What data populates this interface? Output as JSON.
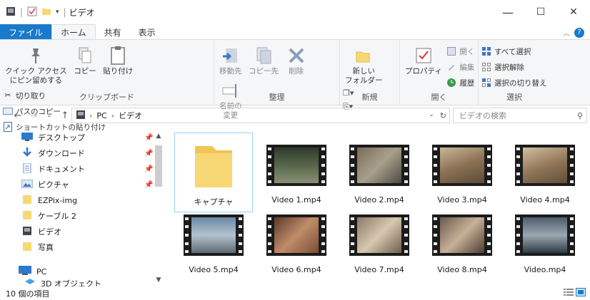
{
  "window": {
    "title": "ビデオ",
    "minimize": "—",
    "maximize": "☐",
    "close": "✕"
  },
  "tabs": [
    {
      "label": "ファイル"
    },
    {
      "label": "ホーム"
    },
    {
      "label": "共有"
    },
    {
      "label": "表示"
    }
  ],
  "ribbon": {
    "clipboard": {
      "label": "クリップボード",
      "pin": "クイック アクセス\nにピン留めする",
      "copy": "コピー",
      "paste": "貼り付け",
      "cut": "切り取り",
      "copy_path": "パスのコピー",
      "paste_shortcut": "ショートカットの貼り付け"
    },
    "organize": {
      "label": "整理",
      "move_to": "移動先",
      "copy_to": "コピー先",
      "delete": "削除",
      "rename": "名前の\n変更"
    },
    "new": {
      "label": "新規",
      "new_folder": "新しい\nフォルダー"
    },
    "open": {
      "label": "開く",
      "properties": "プロパティ",
      "open": "開く",
      "edit": "編集",
      "history": "履歴"
    },
    "select": {
      "label": "選択",
      "select_all": "すべて選択",
      "select_none": "選択解除",
      "invert": "選択の切り替え"
    }
  },
  "address": {
    "path": [
      "PC",
      "ビデオ"
    ],
    "search_placeholder": "ビデオの検索"
  },
  "nav_pane": [
    {
      "label": "デスクトップ",
      "icon": "desktop-icon",
      "pinned": true
    },
    {
      "label": "ダウンロード",
      "icon": "download-icon",
      "pinned": true
    },
    {
      "label": "ドキュメント",
      "icon": "document-icon",
      "pinned": true
    },
    {
      "label": "ピクチャ",
      "icon": "pictures-icon",
      "pinned": true
    },
    {
      "label": "EZPix-img",
      "icon": "folder-icon",
      "pinned": false
    },
    {
      "label": "ケーブル 2",
      "icon": "folder-icon",
      "pinned": false
    },
    {
      "label": "ビデオ",
      "icon": "video-folder-icon",
      "pinned": false
    },
    {
      "label": "写真",
      "icon": "folder-icon",
      "pinned": false
    },
    {
      "label": "PC",
      "icon": "pc-icon",
      "pinned": false
    },
    {
      "label": "3D オブジェクト",
      "icon": "3d-objects-icon",
      "pinned": false
    }
  ],
  "items": [
    {
      "name": "キャプチャ",
      "type": "folder"
    },
    {
      "name": "Video 1.mp4",
      "type": "video"
    },
    {
      "name": "Video 2.mp4",
      "type": "video"
    },
    {
      "name": "Video 3.mp4",
      "type": "video"
    },
    {
      "name": "Video 4.mp4",
      "type": "video"
    },
    {
      "name": "Video 5.mp4",
      "type": "video"
    },
    {
      "name": "Video 6.mp4",
      "type": "video"
    },
    {
      "name": "Video 7.mp4",
      "type": "video"
    },
    {
      "name": "Video 8.mp4",
      "type": "video"
    },
    {
      "name": "Video.mp4",
      "type": "video"
    }
  ],
  "status": {
    "count": "10 個の項目"
  },
  "colors": {
    "accent": "#1979ca",
    "folder": "#f8d775",
    "selection": "#99d1ff"
  }
}
